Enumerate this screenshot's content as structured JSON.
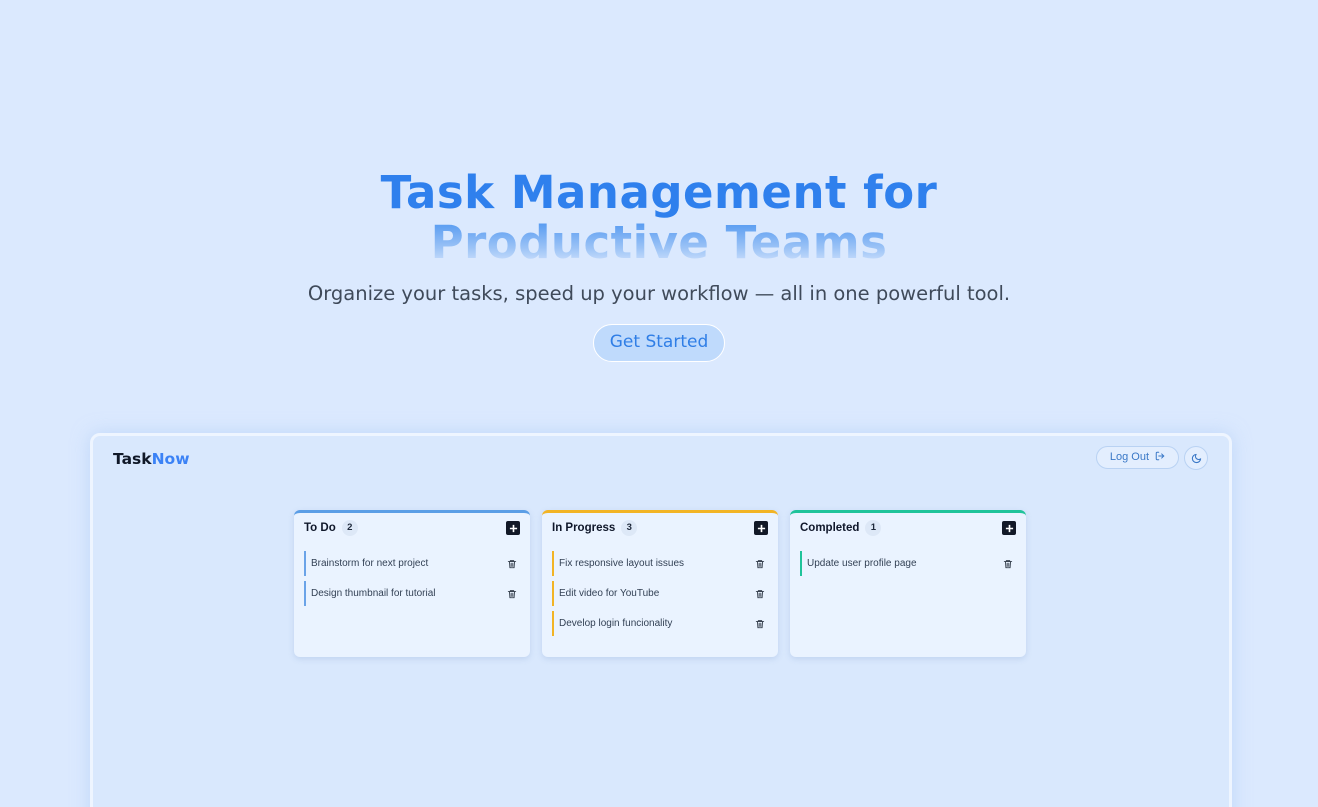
{
  "hero": {
    "title_line1": "Task Management for",
    "title_line2": "Productive Teams",
    "subtitle": "Organize your tasks, speed up your workflow — all in one powerful tool.",
    "cta_label": "Get Started"
  },
  "app": {
    "brand_part1": "Task",
    "brand_part2": "Now",
    "logout_label": "Log Out",
    "columns": [
      {
        "title": "To Do",
        "count": "2",
        "tasks": [
          "Brainstorm for next project",
          "Design thumbnail for tutorial"
        ]
      },
      {
        "title": "In Progress",
        "count": "3",
        "tasks": [
          "Fix responsive layout issues",
          "Edit video for YouTube",
          "Develop login funcionality"
        ]
      },
      {
        "title": "Completed",
        "count": "1",
        "tasks": [
          "Update user profile page"
        ]
      }
    ]
  },
  "colors": {
    "background": "#dbe9fe",
    "accent": "#2f80ed",
    "todo": "#5b9ee6",
    "in_progress": "#f2b425",
    "completed": "#1fc39a"
  },
  "icons": [
    "logout-icon",
    "moon-icon",
    "plus-icon",
    "trash-icon"
  ]
}
